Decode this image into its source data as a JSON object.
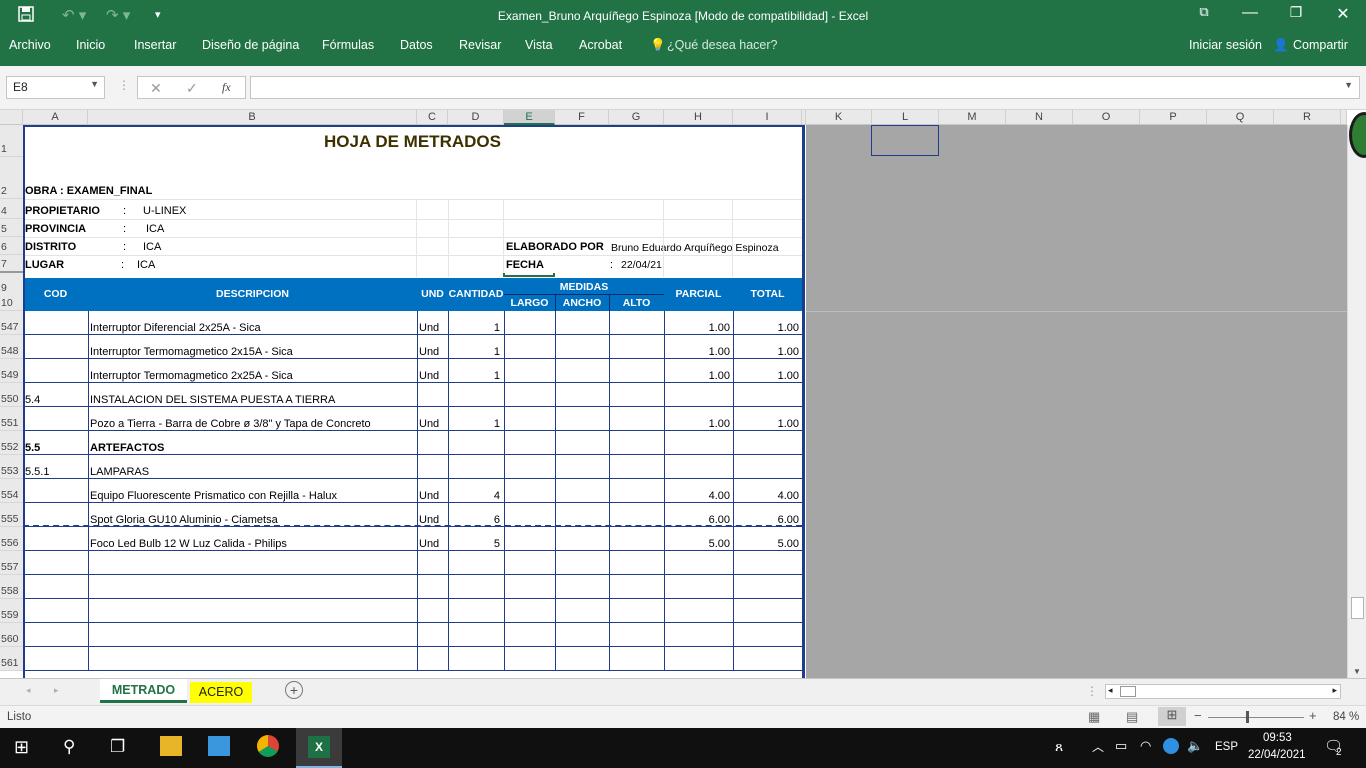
{
  "window": {
    "title": "Examen_Bruno Arquíñego Espinoza  [Modo de compatibilidad] - Excel",
    "save_icon": "save-icon",
    "undo_icon": "undo-icon",
    "redo_icon": "redo-icon",
    "customize_icon": "customize-qat-icon"
  },
  "ribbon": {
    "tabs": [
      "Archivo",
      "Inicio",
      "Insertar",
      "Diseño de página",
      "Fórmulas",
      "Datos",
      "Revisar",
      "Vista",
      "Acrobat"
    ],
    "tell_me": "¿Qué desea hacer?",
    "sign_in": "Iniciar sesión",
    "share": "Compartir"
  },
  "formula_bar": {
    "name_box": "E8",
    "fx": "fx",
    "value": ""
  },
  "columns": [
    "A",
    "B",
    "C",
    "D",
    "E",
    "F",
    "G",
    "H",
    "I",
    "J",
    "K",
    "L",
    "M",
    "N",
    "O",
    "P",
    "Q",
    "R"
  ],
  "sheet": {
    "title": "HOJA DE METRADOS",
    "obra": "OBRA  :  EXAMEN_FINAL",
    "propietario_label": "PROPIETARIO",
    "propietario_value": "U-LINEX",
    "provincia_label": "PROVINCIA",
    "provincia_value": "ICA",
    "distrito_label": "DISTRITO",
    "distrito_value": "ICA",
    "lugar_label": "LUGAR",
    "lugar_value": "ICA",
    "colon": ":",
    "elaborado_label": "ELABORADO POR",
    "elaborado_value": "Bruno Eduardo  Arquíñego Espinoza",
    "fecha_label": "FECHA",
    "fecha_value": "22/04/21",
    "headers": {
      "cod": "COD",
      "descripcion": "DESCRIPCION",
      "und": "UND",
      "cantidad": "CANTIDAD",
      "medidas": "MEDIDAS",
      "largo": "LARGO",
      "ancho": "ANCHO",
      "alto": "ALTO",
      "parcial": "PARCIAL",
      "total": "TOTAL"
    }
  },
  "header_rows": [
    "1",
    "2",
    "4",
    "5",
    "6",
    "7",
    "9",
    "10"
  ],
  "rows": [
    {
      "n": "547",
      "cod": "",
      "desc": "Interruptor Diferencial 2x25A - Sica",
      "und": "Und",
      "cant": "1",
      "parcial": "1.00",
      "total": "1.00",
      "bold": false
    },
    {
      "n": "548",
      "cod": "",
      "desc": "Interruptor Termomagmetico 2x15A - Sica",
      "und": "Und",
      "cant": "1",
      "parcial": "1.00",
      "total": "1.00",
      "bold": false
    },
    {
      "n": "549",
      "cod": "",
      "desc": "Interruptor Termomagmetico 2x25A - Sica",
      "und": "Und",
      "cant": "1",
      "parcial": "1.00",
      "total": "1.00",
      "bold": false
    },
    {
      "n": "550",
      "cod": "5.4",
      "desc": "INSTALACION DEL SISTEMA PUESTA A TIERRA",
      "und": "",
      "cant": "",
      "parcial": "",
      "total": "",
      "bold": false
    },
    {
      "n": "551",
      "cod": "",
      "desc": "Pozo a Tierra - Barra de Cobre ø 3/8\" y Tapa de Concreto",
      "und": "Und",
      "cant": "1",
      "parcial": "1.00",
      "total": "1.00",
      "bold": false
    },
    {
      "n": "552",
      "cod": "5.5",
      "desc": "ARTEFACTOS",
      "und": "",
      "cant": "",
      "parcial": "",
      "total": "",
      "bold": true
    },
    {
      "n": "553",
      "cod": "5.5.1",
      "desc": "LAMPARAS",
      "und": "",
      "cant": "",
      "parcial": "",
      "total": "",
      "bold": false
    },
    {
      "n": "554",
      "cod": "",
      "desc": "Equipo Fluorescente Prismatico con Rejilla - Halux",
      "und": "Und",
      "cant": "4",
      "parcial": "4.00",
      "total": "4.00",
      "bold": false
    },
    {
      "n": "555",
      "cod": "",
      "desc": "Spot Gloria GU10 Aluminio - Ciametsa",
      "und": "Und",
      "cant": "6",
      "parcial": "6.00",
      "total": "6.00",
      "bold": false
    },
    {
      "n": "556",
      "cod": "",
      "desc": "Foco Led Bulb 12 W Luz Calida - Philips",
      "und": "Und",
      "cant": "5",
      "parcial": "5.00",
      "total": "5.00",
      "bold": false
    },
    {
      "n": "557",
      "cod": "",
      "desc": "",
      "und": "",
      "cant": "",
      "parcial": "",
      "total": "",
      "bold": false
    },
    {
      "n": "558",
      "cod": "",
      "desc": "",
      "und": "",
      "cant": "",
      "parcial": "",
      "total": "",
      "bold": false
    },
    {
      "n": "559",
      "cod": "",
      "desc": "",
      "und": "",
      "cant": "",
      "parcial": "",
      "total": "",
      "bold": false
    },
    {
      "n": "560",
      "cod": "",
      "desc": "",
      "und": "",
      "cant": "",
      "parcial": "",
      "total": "",
      "bold": false
    },
    {
      "n": "561",
      "cod": "",
      "desc": "",
      "und": "",
      "cant": "",
      "parcial": "",
      "total": "",
      "bold": false
    }
  ],
  "sheet_tabs": [
    {
      "label": "METRADO",
      "color": "#ffffff",
      "active": true
    },
    {
      "label": "ACERO",
      "color": "#ffff00",
      "active": false
    }
  ],
  "status": {
    "ready": "Listo",
    "zoom": "84 %"
  },
  "taskbar": {
    "lang": "ESP",
    "time": "09:53",
    "date": "22/04/2021",
    "notifications": "2"
  }
}
